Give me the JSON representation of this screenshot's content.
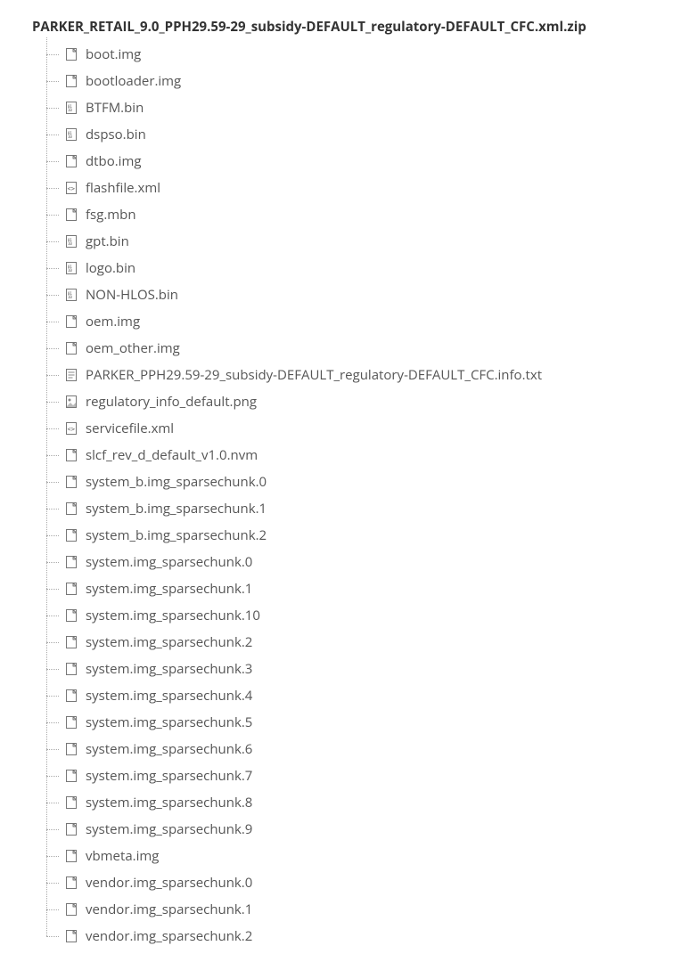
{
  "archive": {
    "name": "PARKER_RETAIL_9.0_PPH29.59-29_subsidy-DEFAULT_regulatory-DEFAULT_CFC.xml.zip"
  },
  "files": [
    {
      "name": "boot.img",
      "icon": "file"
    },
    {
      "name": "bootloader.img",
      "icon": "file"
    },
    {
      "name": "BTFM.bin",
      "icon": "bin"
    },
    {
      "name": "dspso.bin",
      "icon": "bin"
    },
    {
      "name": "dtbo.img",
      "icon": "file"
    },
    {
      "name": "flashfile.xml",
      "icon": "xml"
    },
    {
      "name": "fsg.mbn",
      "icon": "file"
    },
    {
      "name": "gpt.bin",
      "icon": "bin"
    },
    {
      "name": "logo.bin",
      "icon": "bin"
    },
    {
      "name": "NON-HLOS.bin",
      "icon": "bin"
    },
    {
      "name": "oem.img",
      "icon": "file"
    },
    {
      "name": "oem_other.img",
      "icon": "file"
    },
    {
      "name": "PARKER_PPH29.59-29_subsidy-DEFAULT_regulatory-DEFAULT_CFC.info.txt",
      "icon": "txt"
    },
    {
      "name": "regulatory_info_default.png",
      "icon": "image"
    },
    {
      "name": "servicefile.xml",
      "icon": "xml"
    },
    {
      "name": "slcf_rev_d_default_v1.0.nvm",
      "icon": "file"
    },
    {
      "name": "system_b.img_sparsechunk.0",
      "icon": "file"
    },
    {
      "name": "system_b.img_sparsechunk.1",
      "icon": "file"
    },
    {
      "name": "system_b.img_sparsechunk.2",
      "icon": "file"
    },
    {
      "name": "system.img_sparsechunk.0",
      "icon": "file"
    },
    {
      "name": "system.img_sparsechunk.1",
      "icon": "file"
    },
    {
      "name": "system.img_sparsechunk.10",
      "icon": "file"
    },
    {
      "name": "system.img_sparsechunk.2",
      "icon": "file"
    },
    {
      "name": "system.img_sparsechunk.3",
      "icon": "file"
    },
    {
      "name": "system.img_sparsechunk.4",
      "icon": "file"
    },
    {
      "name": "system.img_sparsechunk.5",
      "icon": "file"
    },
    {
      "name": "system.img_sparsechunk.6",
      "icon": "file"
    },
    {
      "name": "system.img_sparsechunk.7",
      "icon": "file"
    },
    {
      "name": "system.img_sparsechunk.8",
      "icon": "file"
    },
    {
      "name": "system.img_sparsechunk.9",
      "icon": "file"
    },
    {
      "name": "vbmeta.img",
      "icon": "file"
    },
    {
      "name": "vendor.img_sparsechunk.0",
      "icon": "file"
    },
    {
      "name": "vendor.img_sparsechunk.1",
      "icon": "file"
    },
    {
      "name": "vendor.img_sparsechunk.2",
      "icon": "file"
    }
  ]
}
